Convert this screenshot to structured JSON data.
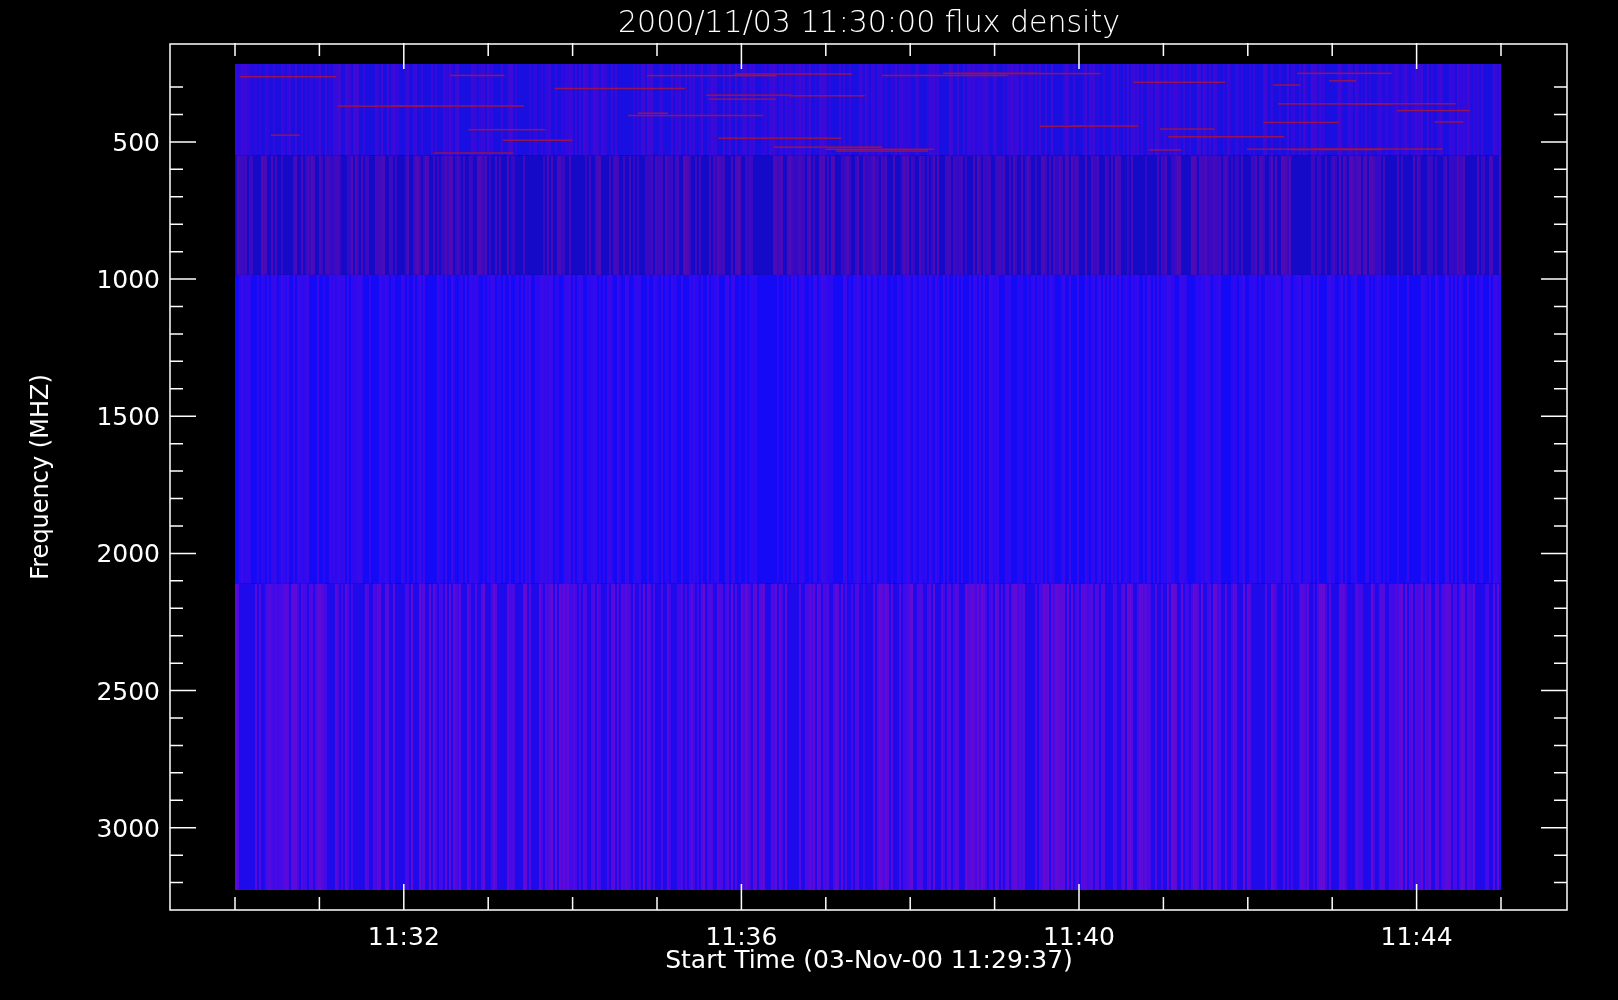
{
  "title": "2000/11/03 11:30:00 flux density",
  "y_axis": {
    "label": "Frequency (MHZ)",
    "ticks": [
      "500",
      "1000",
      "1500",
      "2000",
      "2500",
      "3000"
    ]
  },
  "x_axis": {
    "label": "Start Time (03-Nov-00 11:29:37)",
    "ticks": [
      "11:32",
      "11:36",
      "11:40",
      "11:44"
    ]
  }
}
